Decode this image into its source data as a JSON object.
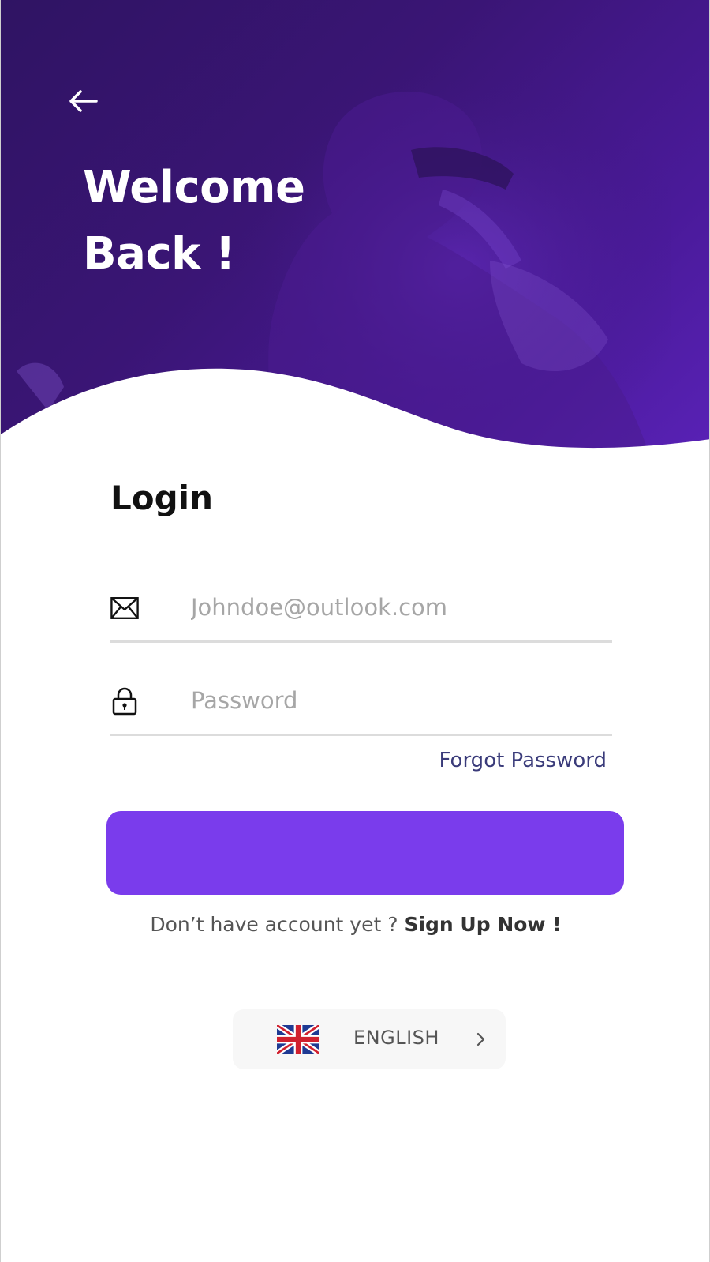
{
  "header": {
    "back_icon": "arrow-left-icon",
    "title_line1": "Welcome",
    "title_line2": "Back !"
  },
  "login": {
    "heading": "Login",
    "email": {
      "icon": "envelope-icon",
      "placeholder": "Johndoe@outlook.com",
      "value": ""
    },
    "password": {
      "icon": "lock-icon",
      "placeholder": "Password",
      "value": ""
    },
    "forgot_password": "Forgot Password",
    "login_button_label": "",
    "signup_prompt": "Don’t have account yet ?",
    "signup_link": "Sign Up Now !"
  },
  "language": {
    "flag_icon": "uk-flag-icon",
    "selected": "ENGLISH",
    "chevron_icon": "chevron-right-icon"
  },
  "colors": {
    "hero_gradient_start": "#2f1463",
    "hero_gradient_end": "#5a22b8",
    "primary_button": "#7a3cec",
    "link": "#3a3b7a",
    "background": "#ffffff"
  }
}
